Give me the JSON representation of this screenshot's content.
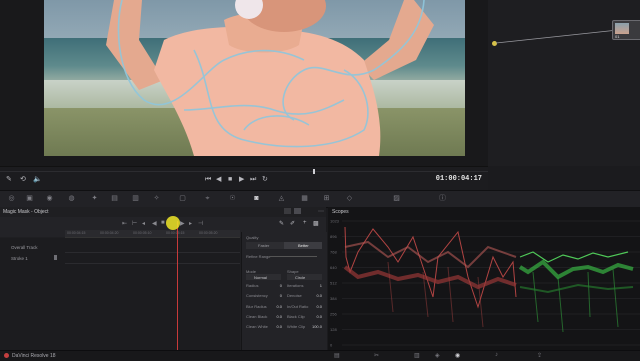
{
  "viewer": {
    "timecode": "01:00:04:17"
  },
  "node": {
    "label": "01"
  },
  "magic_mask": {
    "title": "Magic Mask - Object",
    "ruler": [
      "00:00:04:15",
      "00:00:04:20",
      "00:00:05:10",
      "00:00:05:15",
      "00:00:05:20"
    ],
    "tracks": [
      "Overall Track",
      "Stroke 1"
    ],
    "quality": {
      "label": "Quality",
      "faster": "Faster",
      "better": "Better",
      "refine_range": "Refine Range",
      "mode_label": "Mode",
      "mode_value": "Normal",
      "shape_label": "Shape",
      "shape_value": "Circle",
      "params": [
        {
          "l": "Radius",
          "v": "0",
          "r": "Iterations",
          "rv": "1"
        },
        {
          "l": "Consistency",
          "v": "0",
          "r": "Denoise",
          "rv": "0.0"
        },
        {
          "l": "Blur Radius",
          "v": "0.0",
          "r": "In/Out Ratio",
          "rv": "0.0"
        },
        {
          "l": "Clean Black",
          "v": "0.0",
          "r": "Black Clip",
          "rv": "0.0"
        },
        {
          "l": "Clean White",
          "v": "0.0",
          "r": "White Clip",
          "rv": "100.0"
        }
      ]
    }
  },
  "scopes": {
    "title": "Scopes",
    "scale": [
      "1023",
      "896",
      "768",
      "640",
      "512",
      "384",
      "256",
      "128",
      "0"
    ]
  },
  "status": {
    "app_name": "DaVinci Resolve 18"
  }
}
